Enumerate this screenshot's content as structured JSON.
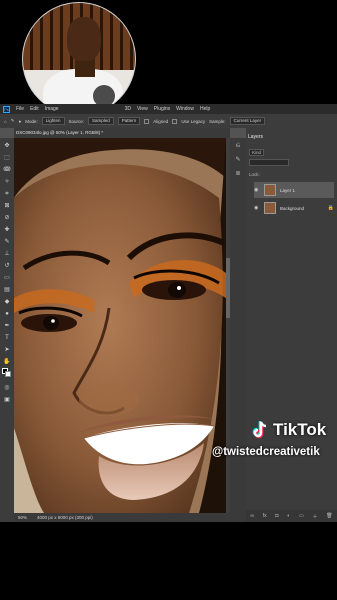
{
  "menubar": {
    "items": [
      "File",
      "Edit",
      "Image",
      "3D",
      "View",
      "Plugins",
      "Window",
      "Help"
    ]
  },
  "options": {
    "mode_label": "Mode:",
    "mode_value": "Lighten",
    "source_label": "Source:",
    "sampled": "Sampled",
    "pattern": "Pattern",
    "aligned": "Aligned",
    "use_legacy": "Use Legacy",
    "sample_label": "Sample:",
    "sample_value": "Current Layer"
  },
  "document": {
    "tab_title": "DSC09034lo.jpg @ 50% (Layer 1, RGB/8) *",
    "zoom": "50%",
    "doc_size": "4000 px x 6000 px (300 ppi)"
  },
  "layers_panel": {
    "title": "Layers",
    "kind": "Kind",
    "lock_label": "Lock:",
    "layers": [
      {
        "name": "Layer 1",
        "selected": true
      },
      {
        "name": "Background",
        "selected": false
      }
    ]
  },
  "watermark": {
    "brand": "TikTok",
    "handle": "@twistedcreativetik"
  },
  "colors": {
    "accent": "#31a8ff",
    "panel_bg": "#3c3c3c"
  }
}
